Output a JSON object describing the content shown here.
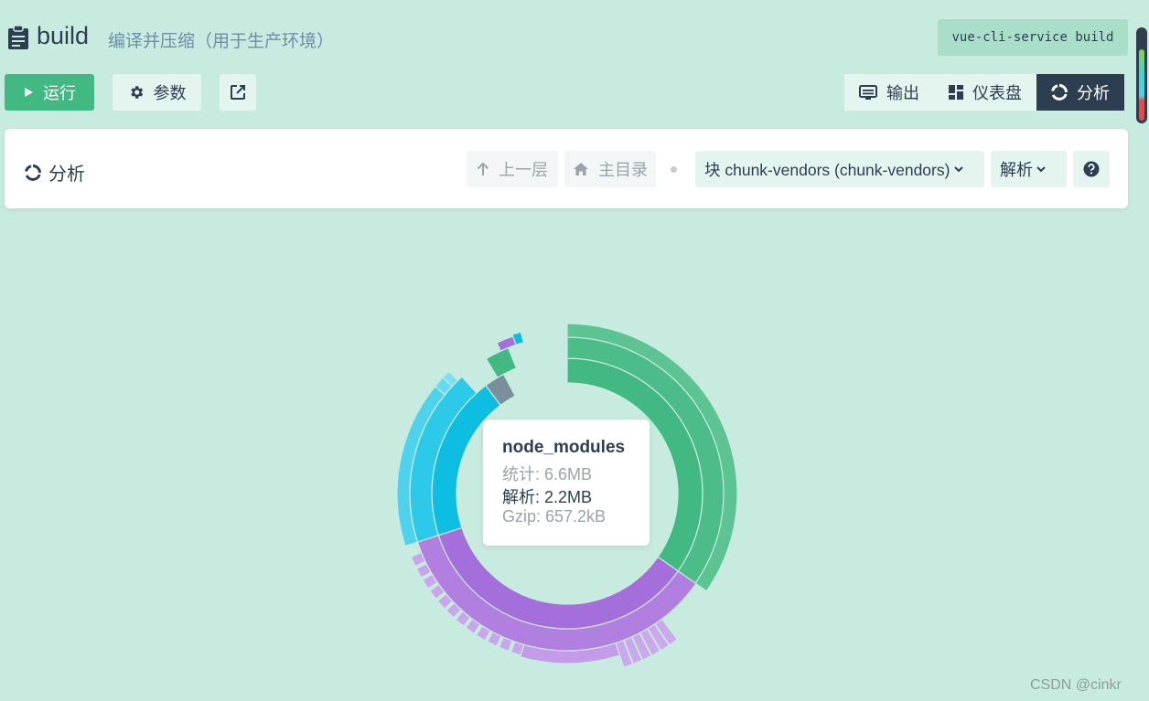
{
  "header": {
    "title": "build",
    "subtitle": "编译并压缩（用于生产环境）",
    "command": "vue-cli-service build"
  },
  "toolbar": {
    "run_label": "运行",
    "params_label": "参数",
    "tabs": [
      {
        "label": "输出",
        "icon": "terminal-icon",
        "active": false
      },
      {
        "label": "仪表盘",
        "icon": "dashboard-icon",
        "active": false
      },
      {
        "label": "分析",
        "icon": "donut-icon",
        "active": true
      }
    ]
  },
  "panel": {
    "title": "分析",
    "up_label": "上一层",
    "home_label": "主目录",
    "chunk_value": "块 chunk-vendors (chunk-vendors)",
    "mode_value": "解析"
  },
  "tooltip": {
    "name": "node_modules",
    "stat": "统计: 6.6MB",
    "parsed": "解析: 2.2MB",
    "gzip": "Gzip: 657.2kB"
  },
  "colors": {
    "accent": "#42b983",
    "dark": "#2c3e50",
    "background": "#c8ebdf"
  },
  "watermark": "CSDN @cinkr"
}
